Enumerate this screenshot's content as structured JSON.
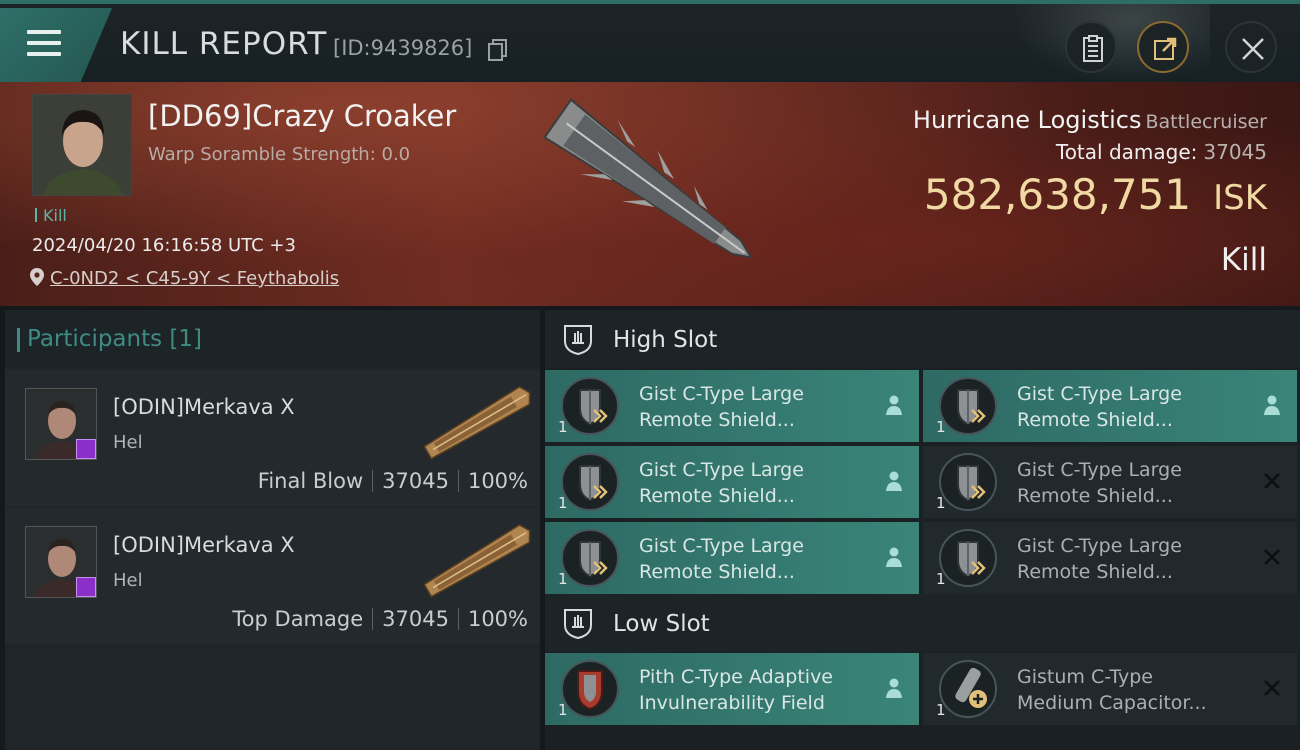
{
  "header": {
    "title": "KILL REPORT",
    "report_id": "[ID:9439826]"
  },
  "victim": {
    "name": "[DD69]Crazy Croaker",
    "warp_scramble": "Warp Soramble Strength: 0.0",
    "kill_tag": "Kill",
    "datetime": "2024/04/20 16:16:58 UTC +3",
    "location": "C-0ND2 < C45-9Y < Feythabolis"
  },
  "ship": {
    "name": "Hurricane Logistics",
    "class": "Battlecruiser",
    "total_damage_label": "Total damage:",
    "total_damage": "37045",
    "isk_value": "582,638,751",
    "isk_unit": "ISK",
    "result": "Kill"
  },
  "participants": {
    "label": "Participants [1]",
    "rows": [
      {
        "name": "[ODIN]Merkava X",
        "corp": "Hel",
        "role": "Final Blow",
        "damage": "37045",
        "percent": "100%"
      },
      {
        "name": "[ODIN]Merkava X",
        "corp": "Hel",
        "role": "Top Damage",
        "damage": "37045",
        "percent": "100%"
      }
    ]
  },
  "high_slot": {
    "label": "High Slot",
    "modules": [
      {
        "line1": "Gist C-Type Large",
        "line2": "Remote Shield...",
        "qty": "1",
        "state": "person-icon"
      },
      {
        "line1": "Gist C-Type Large",
        "line2": "Remote Shield...",
        "qty": "1",
        "state": "person-icon"
      },
      {
        "line1": "Gist C-Type Large",
        "line2": "Remote Shield...",
        "qty": "1",
        "state": "person-icon"
      },
      {
        "line1": "Gist C-Type Large",
        "line2": "Remote Shield...",
        "qty": "1",
        "state": "x-icon"
      },
      {
        "line1": "Gist C-Type Large",
        "line2": "Remote Shield...",
        "qty": "1",
        "state": "person-icon"
      },
      {
        "line1": "Gist C-Type Large",
        "line2": "Remote Shield...",
        "qty": "1",
        "state": "x-icon"
      }
    ]
  },
  "low_slot": {
    "label": "Low Slot",
    "modules": [
      {
        "line1": "Pith C-Type Adaptive",
        "line2": "Invulnerability Field",
        "qty": "1",
        "state": "person-icon"
      },
      {
        "line1": "Gistum C-Type",
        "line2": "Medium Capacitor...",
        "qty": "1",
        "state": "x-icon"
      }
    ]
  },
  "colors": {
    "accent_teal": "#3a8478",
    "isk_gold": "#f0d9a3",
    "banner_red": "#6e2d22",
    "badge_purple": "#8b2fc9"
  }
}
